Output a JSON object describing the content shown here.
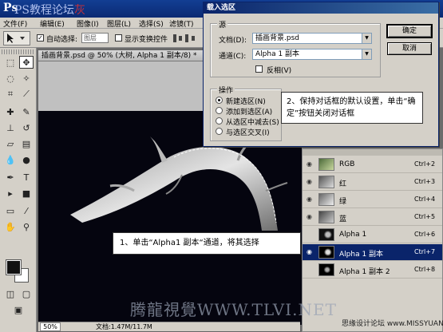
{
  "app": {
    "logo_text": "Ps",
    "watermark_top": "PS教程论坛",
    "watermark_top_accent": "灰"
  },
  "menu": [
    "文件(F)",
    "编辑(E)",
    "图像(I)",
    "图层(L)",
    "选择(S)",
    "滤镜(T)"
  ],
  "options": {
    "auto_select_label": "自动选择:",
    "auto_select_value": "图层",
    "show_transform_label": "显示变换控件"
  },
  "document": {
    "title": "插画背景.psd @ 50% (大树, Alpha 1 副本/8) *",
    "zoom": "50%",
    "doc_info": "文档:1.47M/11.7M"
  },
  "dialog": {
    "title": "载入选区",
    "source_group": "源",
    "doc_label": "文档(D):",
    "doc_value": "插画背景.psd",
    "channel_label": "通道(C):",
    "channel_value": "Alpha 1 副本",
    "invert_label": "反相(V)",
    "operation_group": "操作",
    "ops": [
      "新建选区(N)",
      "添加到选区(A)",
      "从选区中减去(S)",
      "与选区交叉(I)"
    ],
    "ok": "确定",
    "cancel": "取消"
  },
  "callouts": {
    "step1": "1、单击“Alpha1 副本“通道，将其选择",
    "step2": "2、保持对话框的默认设置，单击“确定”按钮关闭对话框"
  },
  "channels": [
    {
      "name": "RGB",
      "shortcut": "Ctrl+2"
    },
    {
      "name": "红",
      "shortcut": "Ctrl+3"
    },
    {
      "name": "绿",
      "shortcut": "Ctrl+4"
    },
    {
      "name": "蓝",
      "shortcut": "Ctrl+5"
    },
    {
      "name": "Alpha 1",
      "shortcut": "Ctrl+6"
    },
    {
      "name": "Alpha 1 副本",
      "shortcut": "Ctrl+7"
    },
    {
      "name": "Alpha 1 副本 2",
      "shortcut": "Ctrl+8"
    }
  ],
  "watermarks": {
    "bottom": "腾龍視覺WWW.TLVI.NET",
    "corner": "思缘设计论坛 www.MISSYUAN.COM"
  },
  "colors": {
    "selection": "#0a246a",
    "canvas": "#05050f"
  }
}
